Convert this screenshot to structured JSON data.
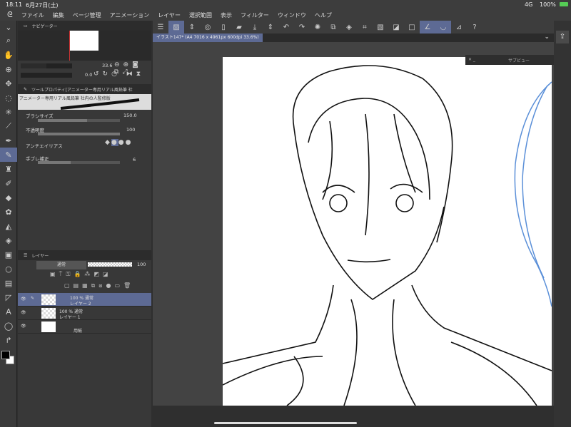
{
  "status": {
    "time": "18:11",
    "date": "6月27日(土)",
    "signal": "4G",
    "battery": "100%"
  },
  "menu": [
    "ファイル",
    "編集",
    "ページ管理",
    "アニメーション",
    "レイヤー",
    "選択範囲",
    "表示",
    "フィルター",
    "ウィンドウ",
    "ヘルプ"
  ],
  "navigator": {
    "title": "ナビゲーター",
    "zoom": "33.6",
    "rotation": "0.0"
  },
  "tool_property": {
    "title": "ツールプロパティ[アニメーター専用リアル風鉛筆 社",
    "brush_name": "アニメーター専用リアル風鉛筆 社内の人監修版",
    "brush_size_label": "ブラシサイズ",
    "brush_size": "150.0",
    "brush_size_fraction": 0.6,
    "opacity_label": "不透明度",
    "opacity": "100",
    "opacity_fraction": 1.0,
    "antialias_label": "アンチエイリアス",
    "stabilizer_label": "手ブレ補正",
    "stabilizer": "6",
    "stabilizer_fraction": 0.4
  },
  "layers": {
    "tab": "レイヤー",
    "blend_mode": "通常",
    "opacity": "100",
    "items": [
      {
        "info": "100 % 通常",
        "name": "レイヤー 2",
        "selected": true
      },
      {
        "info": "100 % 通常",
        "name": "レイヤー 1",
        "selected": false
      },
      {
        "info": "",
        "name": "用紙",
        "selected": false
      }
    ]
  },
  "document": {
    "tab": "イラスト147* (A4 7016 x 4961px 600dpi 33.6%)"
  },
  "subview": {
    "title": "サブビュー"
  },
  "colors": {
    "accent": "#5d6a94",
    "main_color": "#000000",
    "sub_color": "#ffffff"
  }
}
